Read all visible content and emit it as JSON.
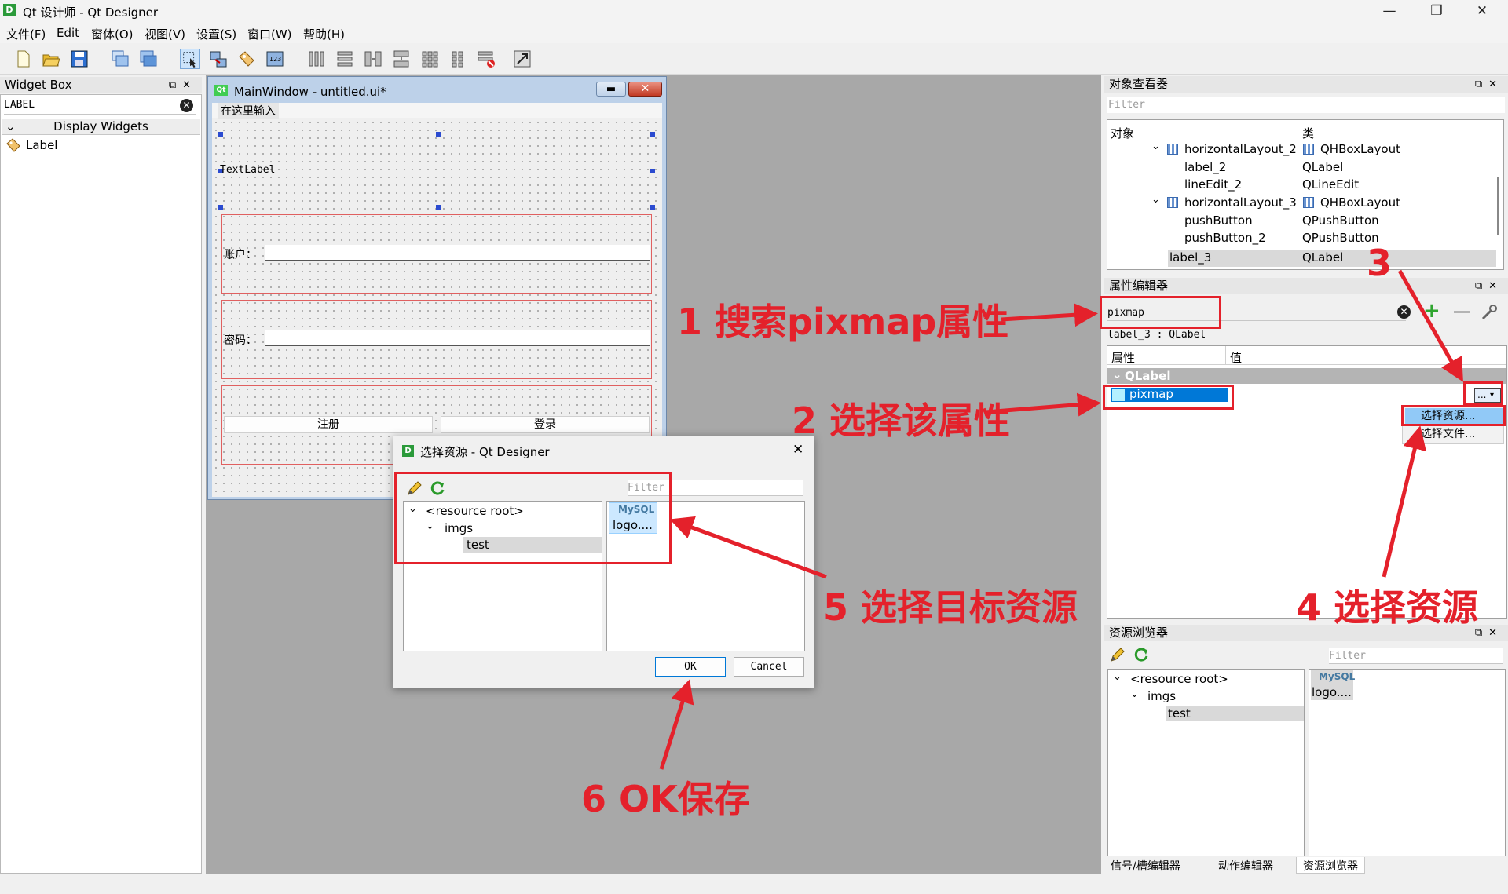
{
  "window": {
    "title": "Qt 设计师 - Qt Designer",
    "minimize": "—",
    "maximize": "❐",
    "close": "✕"
  },
  "menu": [
    "文件(F)",
    "Edit",
    "窗体(O)",
    "视图(V)",
    "设置(S)",
    "窗口(W)",
    "帮助(H)"
  ],
  "widget_box": {
    "title": "Widget Box",
    "search_value": "LABEL",
    "category": "Display Widgets",
    "item": "Label"
  },
  "form": {
    "title": "MainWindow - untitled.ui*",
    "menu_placeholder": "在这里输入",
    "text_label": "TextLabel",
    "account_label": "账户：",
    "password_label": "密码：",
    "register_button": "注册",
    "login_button": "登录"
  },
  "object_inspector": {
    "title": "对象查看器",
    "filter_placeholder": "Filter",
    "col_object": "对象",
    "col_class": "类",
    "rows": [
      {
        "name": "horizontalLayout_2",
        "cls": "QHBoxLayout"
      },
      {
        "name": "label_2",
        "cls": "QLabel"
      },
      {
        "name": "lineEdit_2",
        "cls": "QLineEdit"
      },
      {
        "name": "horizontalLayout_3",
        "cls": "QHBoxLayout"
      },
      {
        "name": "pushButton",
        "cls": "QPushButton"
      },
      {
        "name": "pushButton_2",
        "cls": "QPushButton"
      },
      {
        "name": "label_3",
        "cls": "QLabel"
      }
    ]
  },
  "property_editor": {
    "title": "属性编辑器",
    "search_value": "pixmap",
    "object_line": "label_3 : QLabel",
    "col_property": "属性",
    "col_value": "值",
    "group": "QLabel",
    "property": "pixmap",
    "dropdown_button": "...",
    "menu": [
      "选择资源...",
      "选择文件..."
    ]
  },
  "resource_browser": {
    "title": "资源浏览器",
    "filter_placeholder": "Filter",
    "root": "<resource root>",
    "folder": "imgs",
    "prefix": "test",
    "file_badge": "MySQL",
    "file_label": "logo...."
  },
  "bottom_tabs": [
    "信号/槽编辑器",
    "动作编辑器",
    "资源浏览器"
  ],
  "dialog": {
    "title": "选择资源 - Qt Designer",
    "filter_placeholder": "Filter",
    "root": "<resource root>",
    "folder": "imgs",
    "prefix": "test",
    "file_badge": "MySQL",
    "file_label": "logo....",
    "ok": "OK",
    "cancel": "Cancel"
  },
  "annotations": {
    "step1": "1 搜索pixmap属性",
    "step2": "2 选择该属性",
    "step3": "3",
    "step4": "4 选择资源",
    "step5": "5 选择目标资源",
    "step6": "6 OK保存"
  },
  "colors": {
    "annotation_red": "#e4212b",
    "selection_blue": "#0078d7",
    "qt_green": "#41cd52"
  }
}
